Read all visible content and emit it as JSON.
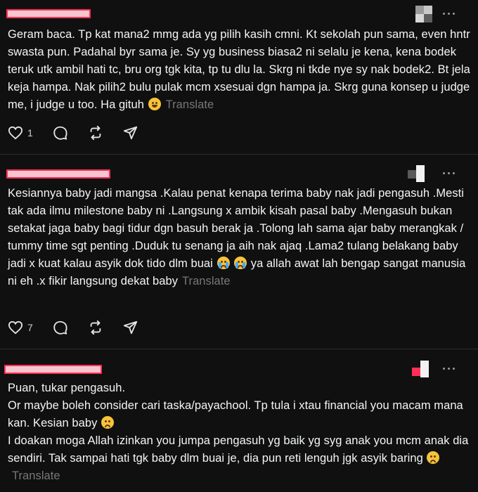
{
  "colors": {
    "background": "#101010",
    "text": "#f3f5f7",
    "muted": "#777777",
    "redaction_fill": "#f7c5d0",
    "redaction_border": "#ff2f55"
  },
  "posts": [
    {
      "text_before": "Geram baca. Tp kat mana2 mmg ada yg pilih kasih cmni. Kt sekolah pun sama, even hntr swasta pun. Padahal byr sama je. Sy yg business biasa2 ni selalu je kena, kena bodek teruk utk ambil hati tc, bru org tgk kita, tp tu dlu la. Skrg ni tkde nye sy nak bodek2. Bt jela keja hampa. Nak pilih2 bulu pulak mcm xsesuai dgn hampa ja. Skrg guna konsep u judge me, i judge u too. Ha gituh",
      "emoji": "rolling-on-floor-laughing",
      "translate_label": "Translate",
      "like_count": "1",
      "icons": [
        "heart-icon",
        "comment-icon",
        "repost-icon",
        "share-icon",
        "more-icon"
      ]
    },
    {
      "text_before": "Kesiannya baby jadi mangsa .Kalau penat kenapa terima baby nak jadi pengasuh .Mesti tak ada ilmu milestone baby ni .Langsung x ambik kisah pasal baby .Mengasuh bukan setakat jaga baby bagi tidur dgn basuh berak ja .Tolong lah sama ajar baby merangkak / tummy time sgt penting .Duduk tu senang ja aih nak ajaq .Lama2 tulang belakang baby jadi x kuat kalau asyik dok tido dlm buai",
      "emoji": "loudly-crying",
      "text_after": "ya allah awat lah bengap sangat manusia ni eh .x fikir langsung dekat baby",
      "translate_label": "Translate",
      "like_count": "7",
      "icons": [
        "heart-icon",
        "comment-icon",
        "repost-icon",
        "share-icon",
        "more-icon"
      ]
    },
    {
      "line1": "Puan, tukar pengasuh.",
      "line2": "Or maybe boleh consider cari taska/payachool. Tp tula i xtau financial you macam mana kan. Kesian baby",
      "emoji": "sad-face",
      "line3": "I doakan moga Allah izinkan you jumpa pengasuh yg baik yg syg anak you mcm anak dia sendiri. Tak sampai hati tgk baby dlm buai je, dia pun reti lenguh jgk asyik baring",
      "translate_label": "Translate",
      "icons": [
        "more-icon"
      ]
    }
  ]
}
